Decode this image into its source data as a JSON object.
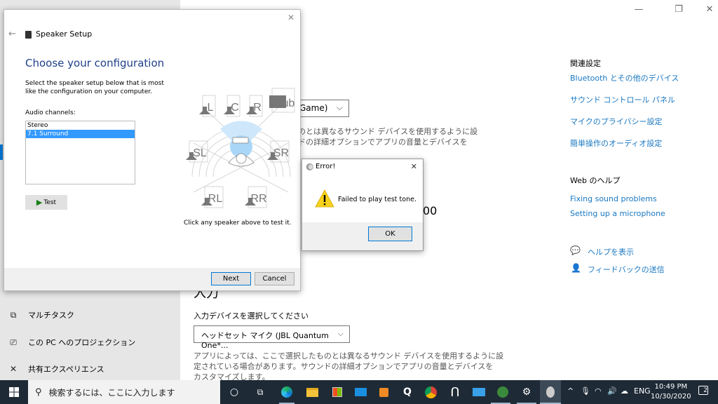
{
  "settings_window": {
    "controls": {
      "minimize": "—",
      "restore": "❐",
      "close": "✕"
    },
    "nav_items": [
      {
        "icon": "multitask-icon",
        "glyph": "⧉",
        "label": "マルチタスク"
      },
      {
        "icon": "projection-icon",
        "glyph": "⎚",
        "label": "この PC へのプロジェクション"
      },
      {
        "icon": "shared-experiences-icon",
        "glyph": "✕",
        "label": "共有エクスペリエンス"
      }
    ],
    "output_device_partial": "Game)",
    "output_desc_line1": "のとは異なるサウンド デバイスを使用するように設",
    "output_desc_line2": "ドの詳細オプションでアプリの音量とデバイスを",
    "volume_partial": "00",
    "input": {
      "heading": "入力",
      "label": "入力デバイスを選択してください",
      "device": "ヘッドセット マイク (JBL Quantum One*...",
      "desc_line1": "アプリによっては、ここで選択したものとは異なるサウンド デバイスを使用するように設",
      "desc_line2": "定されている場合があります。サウンドの詳細オプションでアプリの音量とデバイスを",
      "desc_line3": "カスタマイズします。"
    },
    "related": {
      "title": "関連設定",
      "links": [
        "Bluetooth とその他のデバイス",
        "サウンド コントロール パネル",
        "マイクのプライバシー設定",
        "簡単操作のオーディオ設定"
      ]
    },
    "web_help": {
      "title": "Web のヘルプ",
      "links": [
        "Fixing sound problems",
        "Setting up a microphone"
      ]
    },
    "help": {
      "get_help": "ヘルプを表示",
      "feedback": "フィードバックの送信"
    }
  },
  "speaker_setup": {
    "title": "Speaker Setup",
    "heading": "Choose your configuration",
    "description": "Select the speaker setup below that is most like the configuration on your computer.",
    "channels_label": "Audio channels:",
    "channels": [
      "Stereo",
      "7.1 Surround"
    ],
    "selected_channel": "7.1 Surround",
    "test_label": "Test",
    "speakers": [
      "L",
      "C",
      "R",
      "Sub",
      "SL",
      "SR",
      "RL",
      "RR"
    ],
    "hint": "Click any speaker above to test it.",
    "next_label": "Next",
    "cancel_label": "Cancel",
    "close": "✕",
    "back": "←"
  },
  "error_dialog": {
    "title": "Error!",
    "message": "Failed to play test tone.",
    "ok_label": "OK",
    "close": "✕"
  },
  "taskbar": {
    "search_placeholder": "検索するには、ここに入力します",
    "apps": [
      "cortana",
      "task-view",
      "edge",
      "file-explorer",
      "store",
      "mail",
      "media-player",
      "q-app",
      "chrome",
      "n-app",
      "remote-desktop",
      "game-app",
      "settings",
      "speaker-setup"
    ],
    "tray": {
      "language": "ENG"
    },
    "time": "10:49 PM",
    "date": "10/30/2020",
    "notifications": "2"
  },
  "colors": {
    "accent": "#0078d7",
    "link": "#1a78c2",
    "heading_blue": "#1f3f8a",
    "taskbar": "#1e2a36"
  }
}
